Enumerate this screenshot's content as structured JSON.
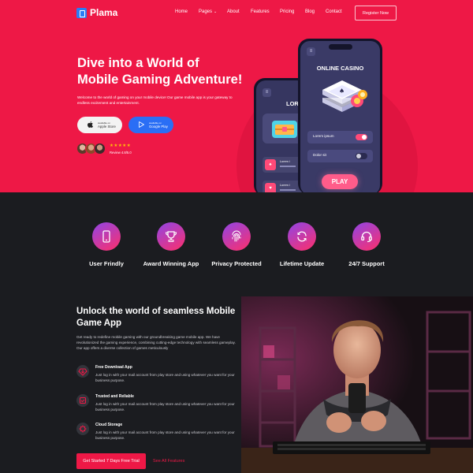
{
  "brand": {
    "name": "Plama"
  },
  "nav": {
    "links": [
      "Home",
      "Pages",
      "About",
      "Features",
      "Pricing",
      "Blog",
      "Contact"
    ],
    "register": "Register Now"
  },
  "hero": {
    "title": "Dive into a World of Mobile Gaming Adventure!",
    "description": "Welcome to the world of gaming on your mobile device! Our game mobile app is your gateway to endless excitement and entertainment.",
    "apple": {
      "small": "available on",
      "big": "Apple Store"
    },
    "google": {
      "small": "available on",
      "big": "Google Play"
    },
    "stars": "★★★★★",
    "review": "Review 4.8/5.0"
  },
  "phone_front": {
    "heading": "ONLINE CASINO",
    "toggles": [
      {
        "label": "Lorem ipsum",
        "state": "on"
      },
      {
        "label": "Dolor sit",
        "state": "off"
      }
    ],
    "play": "PLAY"
  },
  "phone_back": {
    "heading": "LOREM",
    "rows": [
      "Lorem i",
      "Lorem i"
    ]
  },
  "features": [
    {
      "label": "User Frindly",
      "icon": "smartphone-icon"
    },
    {
      "label": "Award Winning App",
      "icon": "trophy-icon"
    },
    {
      "label": "Privacy Protected",
      "icon": "fingerprint-icon"
    },
    {
      "label": "Lifetime Update",
      "icon": "refresh-icon"
    },
    {
      "label": "24/7 Support",
      "icon": "headset-icon"
    }
  ],
  "about": {
    "title": "Unlock the world of seamless Mobile Game App",
    "description": "Get ready to redefine mobile gaming with our groundbreaking game mobile app. We have revolutionized the gaming experience, combining cutting-edge technology with seamless gameplay. Our app offers a diverse collection of games meticulously",
    "items": [
      {
        "title": "Free Download App",
        "desc": "Just log in with your mail account from play store and using whatever you want for your business purpose.",
        "icon": "download-icon"
      },
      {
        "title": "Trusted and Reliable",
        "desc": "Just log in with your mail account from play store and using whatever you want for your business purpose.",
        "icon": "shield-icon"
      },
      {
        "title": "Cloud Storage",
        "desc": "Just log in with your mail account from play store and using whatever you want for your business purpose.",
        "icon": "cloud-icon"
      }
    ],
    "cta": "Get Started 7 Days Free Trial",
    "link": "See All Features"
  },
  "colors": {
    "brand_red": "#ee1846",
    "dark_bg": "#1b1c20",
    "accent_blue": "#2a6ef5",
    "gradient_start": "#8f45e6",
    "gradient_end": "#ff2f6a"
  }
}
